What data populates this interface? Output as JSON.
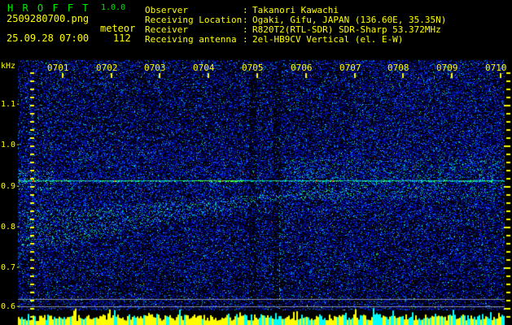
{
  "header": {
    "title": "H R O F F T",
    "version": "1.0.0",
    "filename": "2509280700.png",
    "mode": "meteor",
    "timestamp": "25.09.28 07:00",
    "count": "112",
    "colon": ":",
    "info_rows": [
      {
        "label": "Observer",
        "value": "Takanori Kawachi"
      },
      {
        "label": "Receiving Location",
        "value": "Ogaki, Gifu, JAPAN (136.60E, 35.35N)"
      },
      {
        "label": "Receiver",
        "value": "R820T2(RTL-SDR) SDR-Sharp 53.372MHz"
      },
      {
        "label": "Receiving antenna",
        "value": "2el-HB9CV Vertical (el. E-W)"
      }
    ]
  },
  "axis": {
    "unit": "kHz",
    "freq_labels": [
      "1.1-",
      "1.0-",
      "0.9-",
      "0.8-",
      "0.7-",
      "0.6-"
    ],
    "time_labels": [
      "0701",
      "0702",
      "0703",
      "0704",
      "0705",
      "0706",
      "0707",
      "0708",
      "0709",
      "0710"
    ]
  },
  "colors": {
    "background": "#000000",
    "title_green": "#00EE00",
    "text_yellow": "#FFFF00",
    "tick_yellow": "#FFFF00",
    "gray_line": "#8890A8",
    "bar_yellow": "#FFFF00",
    "bar_cyan": "#00FFFF",
    "carrier_cyan": "#00A8C8",
    "echo_green": "#3CFF5A",
    "echo_red": "#FF3300"
  },
  "spectrogram": {
    "seed": 20250928
  },
  "chart_data": {
    "type": "heatmap",
    "title": "HROFFT 1.0.0 radio meteor echo spectrogram",
    "ylabel": "kHz",
    "ytick_labels": [
      1.1,
      1.0,
      0.9,
      0.8,
      0.7,
      0.6
    ],
    "xtick_labels": [
      "0701",
      "0702",
      "0703",
      "0704",
      "0705",
      "0706",
      "0707",
      "0708",
      "0709",
      "0710"
    ],
    "x_range": [
      "07:00",
      "07:10"
    ],
    "y_range_khz": [
      0.58,
      1.18
    ],
    "meteor_count": 112,
    "legend_position": "none",
    "grid": false,
    "notable_features": [
      "continuous carrier echo line at ~0.92 kHz, cyan-green with sporadic red bursts",
      "doppler-drifting echo wedge rising from ~0.78 kHz at 0700 to ~0.92 kHz near 0706",
      "diffuse green echo activity around 0.88-0.95 kHz after 0705",
      "dark vertical attenuation streaks near 0705 and 0705:30",
      "two gray reference lines near 0.62 kHz",
      "bottom activity bargraph: yellow (signal) and cyan (echo) columns"
    ]
  }
}
